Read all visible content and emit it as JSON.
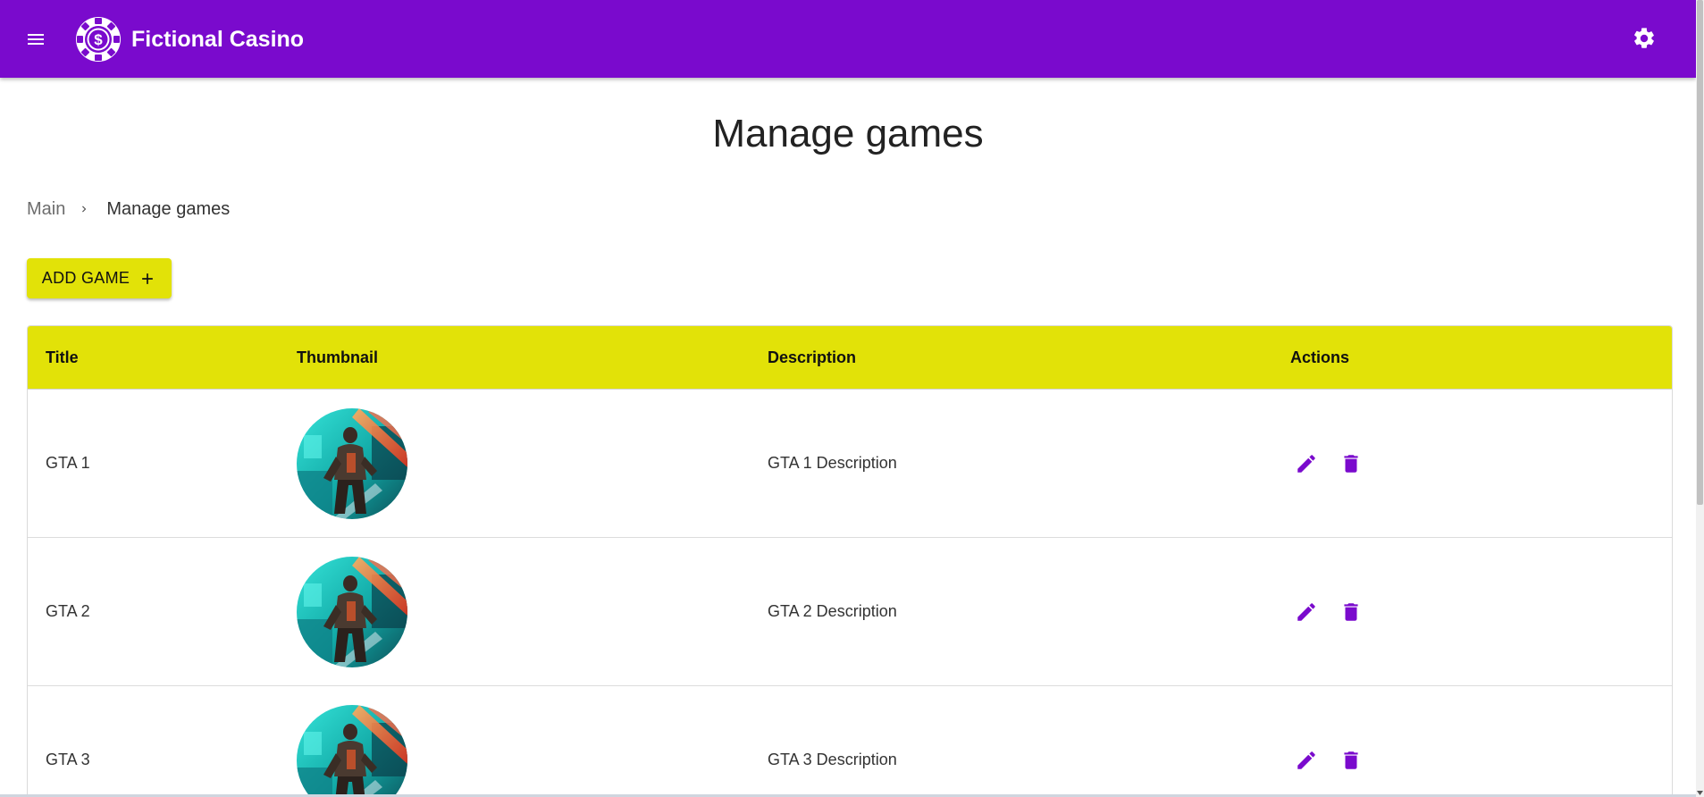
{
  "app": {
    "title": "Fictional Casino",
    "brand_color": "#7a0acd",
    "accent_color": "#e2e208",
    "icons": {
      "menu": "menu-icon",
      "logo": "casino-chip-dollar-icon",
      "settings": "gear-icon"
    }
  },
  "page": {
    "title": "Manage games"
  },
  "breadcrumb": {
    "items": [
      "Main",
      "Manage games"
    ]
  },
  "toolbar": {
    "add_label": "ADD GAME",
    "add_icon": "plus-icon"
  },
  "table": {
    "columns": [
      "Title",
      "Thumbnail",
      "Description",
      "Actions"
    ],
    "rows": [
      {
        "title": "GTA 1",
        "description": "GTA 1 Description"
      },
      {
        "title": "GTA 2",
        "description": "GTA 2 Description"
      },
      {
        "title": "GTA 3",
        "description": "GTA 3 Description"
      }
    ],
    "row_action_icons": [
      "edit-pencil-icon",
      "delete-trash-icon"
    ]
  }
}
